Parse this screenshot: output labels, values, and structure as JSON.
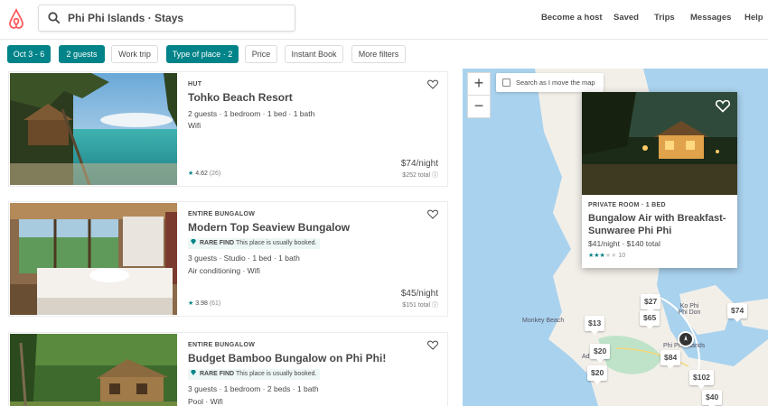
{
  "header": {
    "search_query": "Phi Phi Islands · Stays",
    "nav": [
      "Become a host",
      "Saved",
      "Trips",
      "Messages",
      "Help"
    ]
  },
  "filters": [
    {
      "label": "Oct 3 - 6",
      "active": true
    },
    {
      "label": "2 guests",
      "active": true
    },
    {
      "label": "Work trip",
      "active": false
    },
    {
      "label": "Type of place · 2",
      "active": true
    },
    {
      "label": "Price",
      "active": false
    },
    {
      "label": "Instant Book",
      "active": false
    },
    {
      "label": "More filters",
      "active": false
    }
  ],
  "listings": [
    {
      "type": "HUT",
      "title": "Tohko Beach Resort",
      "rare_find": null,
      "details": [
        "2 guests · 1 bedroom · 1 bed · 1 bath",
        "Wifi"
      ],
      "rating": "4.62",
      "reviews": "(26)",
      "price": "$74/night",
      "total": "$252 total"
    },
    {
      "type": "ENTIRE BUNGALOW",
      "title": "Modern Top Seaview Bungalow",
      "rare_find": {
        "label": "RARE FIND",
        "text": "This place is usually booked."
      },
      "details": [
        "3 guests · Studio · 1 bed · 1 bath",
        "Air conditioning · Wifi"
      ],
      "rating": "3.98",
      "reviews": "(61)",
      "price": "$45/night",
      "total": "$151 total"
    },
    {
      "type": "ENTIRE BUNGALOW",
      "title": "Budget Bamboo Bungalow on Phi Phi!",
      "rare_find": {
        "label": "RARE FIND",
        "text": "This place is usually booked."
      },
      "details": [
        "3 guests · 1 bedroom · 2 beds · 1 bath",
        "Pool · Wifi"
      ],
      "rating": "",
      "reviews": "",
      "price": "",
      "total": ""
    }
  ],
  "map": {
    "search_as_move": "Search as I move the map",
    "zoom_in": "+",
    "zoom_out": "−",
    "labels": {
      "ko_phi_phi_don": "Ko Phi Phi Don",
      "monkey_beach": "Monkey Beach",
      "phi_phi_islands": "Phi Phi Islands",
      "pier": "Ad... Pier"
    },
    "pins": [
      "$27",
      "$65",
      "$13",
      "$74",
      "$20",
      "$84",
      "$20",
      "$102",
      "$40"
    ],
    "popup": {
      "type": "PRIVATE ROOM · 1 BED",
      "title": "Bungalow Air with Breakfast-Sunwaree Phi Phi",
      "price": "$41/night · $140 total",
      "reviews": "10"
    }
  },
  "colors": {
    "brand": "#ff5a5f",
    "accent": "#008489",
    "water": "#a9d2ee",
    "land": "#f2efe9"
  }
}
